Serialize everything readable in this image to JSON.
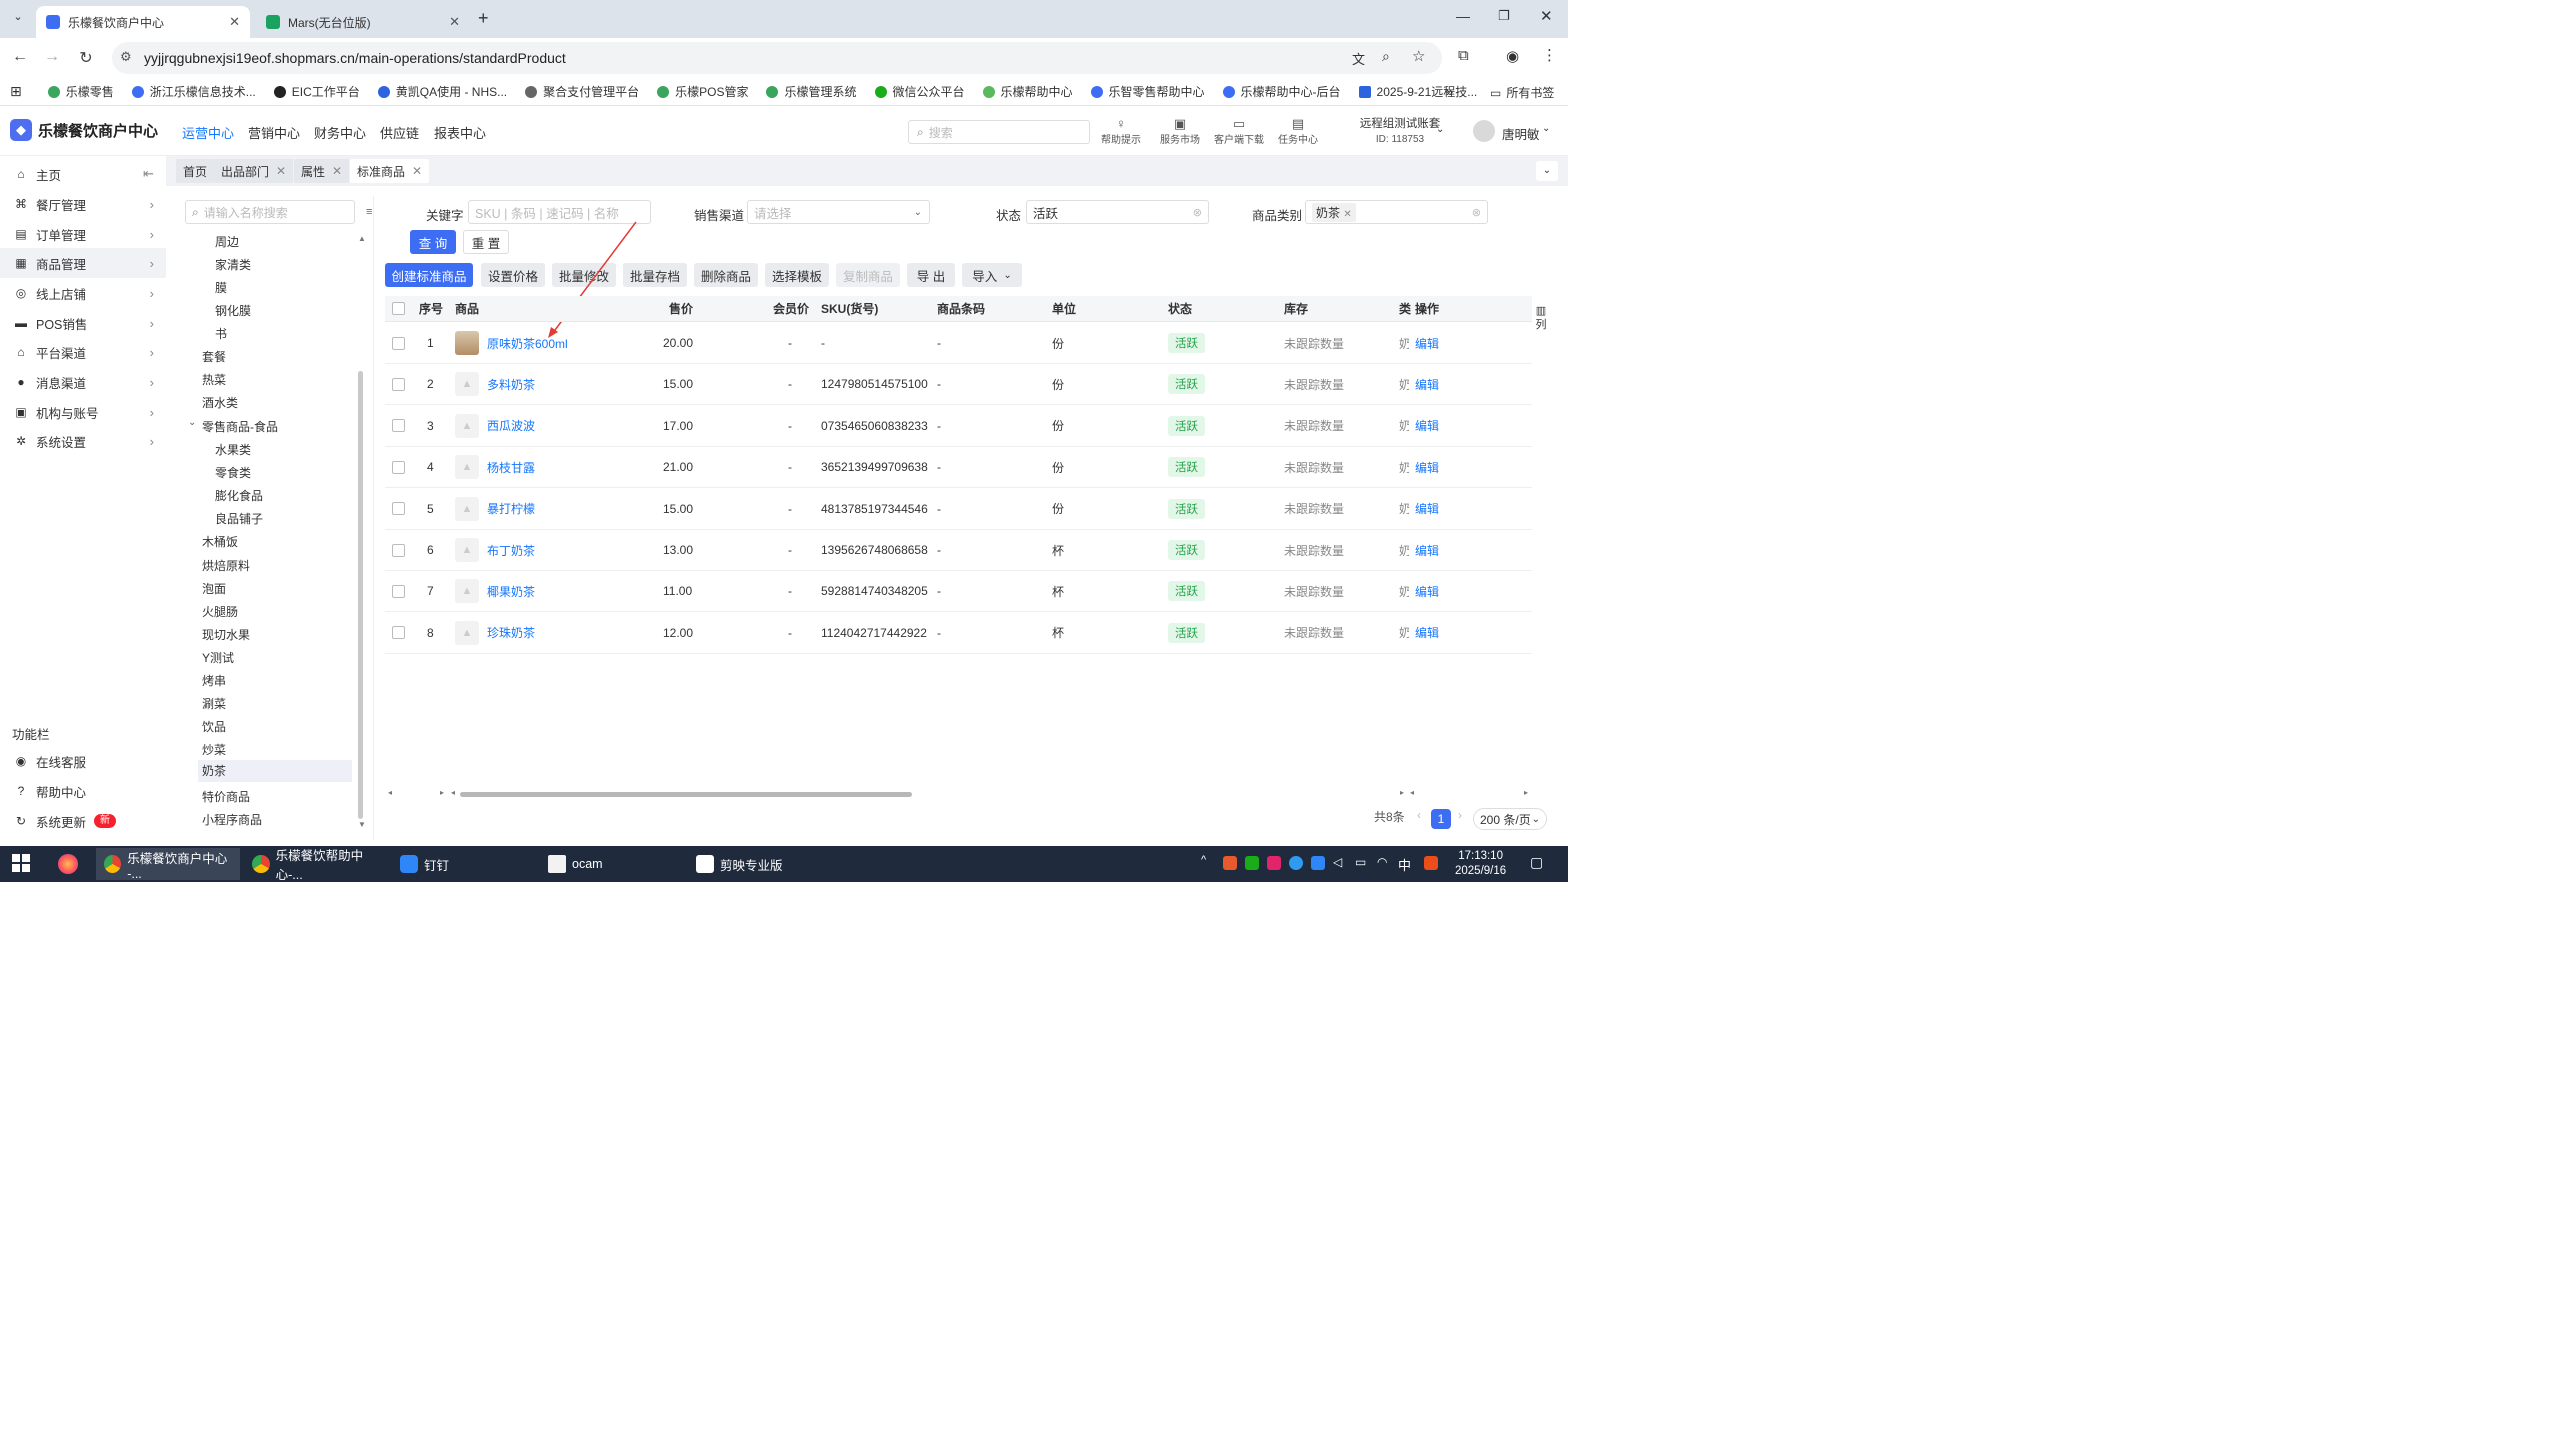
{
  "browser": {
    "tabs": [
      {
        "title": "乐檬餐饮商户中心",
        "active": true
      },
      {
        "title": "Mars(无台位版)",
        "active": false
      }
    ],
    "url": "yyjjrqgubnexjsi19eof.shopmars.cn/main-operations/standardProduct",
    "bookmarks": [
      "乐檬零售",
      "浙江乐檬信息技术...",
      "EIC工作平台",
      "黄凯QA使用 - NHS...",
      "聚合支付管理平台",
      "乐檬POS管家",
      "乐檬管理系统",
      "微信公众平台",
      "乐檬帮助中心",
      "乐智零售帮助中心",
      "乐檬帮助中心-后台",
      "2025-9-21远程技..."
    ],
    "all_bookmarks": "所有书签"
  },
  "header": {
    "app_name": "乐檬餐饮商户中心",
    "nav": [
      "运营中心",
      "营销中心",
      "财务中心",
      "供应链",
      "报表中心"
    ],
    "search_placeholder": "搜索",
    "tools": [
      "帮助提示",
      "服务市场",
      "客户端下载",
      "任务中心"
    ],
    "account_name": "远程组测试账套",
    "account_id": "ID: 118753",
    "user": "唐明敏"
  },
  "sidebar": {
    "items": [
      "主页",
      "餐厅管理",
      "订单管理",
      "商品管理",
      "线上店铺",
      "POS销售",
      "平台渠道",
      "消息渠道",
      "机构与账号",
      "系统设置"
    ],
    "section_label": "功能栏",
    "bottom": [
      "在线客服",
      "帮助中心",
      "系统更新"
    ],
    "new_badge": "新"
  },
  "tags": [
    "首页",
    "出品部门",
    "属性",
    "标准商品"
  ],
  "tree": {
    "search_placeholder": "请输入名称搜索",
    "nodes": [
      "周边",
      "家清类",
      "膜",
      "钢化膜",
      "书",
      "套餐",
      "热菜",
      "酒水类",
      "零售商品-食品",
      "水果类",
      "零食类",
      "膨化食品",
      "良品铺子",
      "木桶饭",
      "烘焙原料",
      "泡面",
      "火腿肠",
      "现切水果",
      "Y测试",
      "烤串",
      "涮菜",
      "饮品",
      "炒菜",
      "奶茶",
      "特价商品",
      "小程序商品"
    ]
  },
  "filters": {
    "keyword_label": "关键字",
    "keyword_placeholder": "SKU | 条码 | 速记码 | 名称",
    "channel_label": "销售渠道",
    "channel_placeholder": "请选择",
    "status_label": "状态",
    "status_value": "活跃",
    "category_label": "商品类别",
    "category_value": "奶茶",
    "query": "查 询",
    "reset": "重 置"
  },
  "toolbar": [
    "创建标准商品",
    "设置价格",
    "批量修改",
    "批量存档",
    "删除商品",
    "选择模板",
    "复制商品",
    "导 出",
    "导入"
  ],
  "table": {
    "headers": [
      "序号",
      "商品",
      "售价",
      "会员价",
      "SKU(货号)",
      "商品条码",
      "单位",
      "状态",
      "库存",
      "类",
      "操作"
    ],
    "column_setting": "列",
    "rows": [
      {
        "no": "1",
        "name": "原味奶茶600ml",
        "price": "20.00",
        "member": "-",
        "sku": "-",
        "barcode": "-",
        "unit": "份",
        "status": "活跃",
        "stock": "未跟踪数量",
        "cat": "奶",
        "op": "编辑"
      },
      {
        "no": "2",
        "name": "多料奶茶",
        "price": "15.00",
        "member": "-",
        "sku": "1247980514575100",
        "barcode": "-",
        "unit": "份",
        "status": "活跃",
        "stock": "未跟踪数量",
        "cat": "奶",
        "op": "编辑"
      },
      {
        "no": "3",
        "name": "西瓜波波",
        "price": "17.00",
        "member": "-",
        "sku": "0735465060838233",
        "barcode": "-",
        "unit": "份",
        "status": "活跃",
        "stock": "未跟踪数量",
        "cat": "奶",
        "op": "编辑"
      },
      {
        "no": "4",
        "name": "杨枝甘露",
        "price": "21.00",
        "member": "-",
        "sku": "3652139499709638",
        "barcode": "-",
        "unit": "份",
        "status": "活跃",
        "stock": "未跟踪数量",
        "cat": "奶",
        "op": "编辑"
      },
      {
        "no": "5",
        "name": "暴打柠檬",
        "price": "15.00",
        "member": "-",
        "sku": "4813785197344546",
        "barcode": "-",
        "unit": "份",
        "status": "活跃",
        "stock": "未跟踪数量",
        "cat": "奶",
        "op": "编辑"
      },
      {
        "no": "6",
        "name": "布丁奶茶",
        "price": "13.00",
        "member": "-",
        "sku": "1395626748068658",
        "barcode": "-",
        "unit": "杯",
        "status": "活跃",
        "stock": "未跟踪数量",
        "cat": "奶",
        "op": "编辑"
      },
      {
        "no": "7",
        "name": "椰果奶茶",
        "price": "11.00",
        "member": "-",
        "sku": "5928814740348205",
        "barcode": "-",
        "unit": "杯",
        "status": "活跃",
        "stock": "未跟踪数量",
        "cat": "奶",
        "op": "编辑"
      },
      {
        "no": "8",
        "name": "珍珠奶茶",
        "price": "12.00",
        "member": "-",
        "sku": "1124042717442922",
        "barcode": "-",
        "unit": "杯",
        "status": "活跃",
        "stock": "未跟踪数量",
        "cat": "奶",
        "op": "编辑"
      }
    ]
  },
  "pagination": {
    "total": "共8条",
    "page": "1",
    "size": "200 条/页"
  },
  "taskbar": {
    "apps": [
      "乐檬餐饮商户中心 -...",
      "乐檬餐饮帮助中心-...",
      "钉钉",
      "ocam",
      "剪映专业版"
    ],
    "time": "17:13:10",
    "date": "2025/9/16",
    "ime": "中"
  },
  "colors": {
    "accent": "#3d6df2",
    "link": "#1677ff",
    "active_badge": "#21a148",
    "taskbar": "#1f2a3c"
  }
}
